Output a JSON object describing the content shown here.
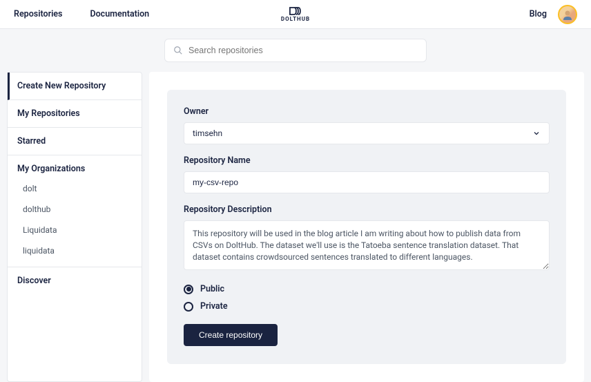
{
  "header": {
    "nav_left": [
      "Repositories",
      "Documentation"
    ],
    "logo_text": "DOLTHUB",
    "blog_label": "Blog"
  },
  "search": {
    "placeholder": "Search repositories"
  },
  "sidebar": {
    "items": [
      {
        "label": "Create New Repository",
        "active": true
      },
      {
        "label": "My Repositories"
      },
      {
        "label": "Starred"
      }
    ],
    "my_orgs_label": "My Organizations",
    "orgs": [
      "dolt",
      "dolthub",
      "Liquidata",
      "liquidata"
    ],
    "discover_label": "Discover"
  },
  "form": {
    "owner_label": "Owner",
    "owner_value": "timsehn",
    "name_label": "Repository Name",
    "name_value": "my-csv-repo",
    "desc_label": "Repository Description",
    "desc_value": "This repository will be used in the blog article I am writing about how to publish data from CSVs on DoltHub. The dataset we'll use is the Tatoeba sentence translation dataset. That dataset contains crowdsourced sentences translated to different languages.",
    "visibility": {
      "public_label": "Public",
      "private_label": "Private",
      "selected": "public"
    },
    "submit_label": "Create repository"
  }
}
